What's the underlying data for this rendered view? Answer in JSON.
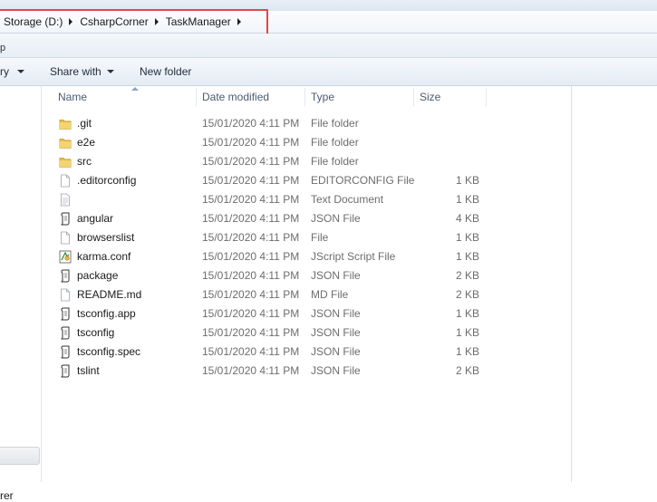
{
  "address": {
    "crumbs": [
      "Storage (D:)",
      "CsharpCorner",
      "TaskManager"
    ]
  },
  "menu_bar": {
    "partial_text": "p"
  },
  "toolbar": {
    "organize_partial": "ry",
    "share_with": "Share with",
    "new_folder": "New folder"
  },
  "nav_pane": {
    "partial_text": "rer"
  },
  "columns": {
    "name": "Name",
    "date": "Date modified",
    "type": "Type",
    "size": "Size"
  },
  "files": [
    {
      "name": ".git",
      "date": "15/01/2020 4:11 PM",
      "type": "File folder",
      "size": "",
      "icon": "folder-icon"
    },
    {
      "name": "e2e",
      "date": "15/01/2020 4:11 PM",
      "type": "File folder",
      "size": "",
      "icon": "folder-icon"
    },
    {
      "name": "src",
      "date": "15/01/2020 4:11 PM",
      "type": "File folder",
      "size": "",
      "icon": "folder-icon"
    },
    {
      "name": ".editorconfig",
      "date": "15/01/2020 4:11 PM",
      "type": "EDITORCONFIG File",
      "size": "1 KB",
      "icon": "file-icon"
    },
    {
      "name": "",
      "date": "15/01/2020 4:11 PM",
      "type": "Text Document",
      "size": "1 KB",
      "icon": "text-document-icon"
    },
    {
      "name": "angular",
      "date": "15/01/2020 4:11 PM",
      "type": "JSON File",
      "size": "4 KB",
      "icon": "json-file-icon"
    },
    {
      "name": "browserslist",
      "date": "15/01/2020 4:11 PM",
      "type": "File",
      "size": "1 KB",
      "icon": "file-icon"
    },
    {
      "name": "karma.conf",
      "date": "15/01/2020 4:11 PM",
      "type": "JScript Script File",
      "size": "1 KB",
      "icon": "jscript-file-icon"
    },
    {
      "name": "package",
      "date": "15/01/2020 4:11 PM",
      "type": "JSON File",
      "size": "2 KB",
      "icon": "json-file-icon"
    },
    {
      "name": "README.md",
      "date": "15/01/2020 4:11 PM",
      "type": "MD File",
      "size": "2 KB",
      "icon": "file-icon"
    },
    {
      "name": "tsconfig.app",
      "date": "15/01/2020 4:11 PM",
      "type": "JSON File",
      "size": "1 KB",
      "icon": "json-file-icon"
    },
    {
      "name": "tsconfig",
      "date": "15/01/2020 4:11 PM",
      "type": "JSON File",
      "size": "1 KB",
      "icon": "json-file-icon"
    },
    {
      "name": "tsconfig.spec",
      "date": "15/01/2020 4:11 PM",
      "type": "JSON File",
      "size": "1 KB",
      "icon": "json-file-icon"
    },
    {
      "name": "tslint",
      "date": "15/01/2020 4:11 PM",
      "type": "JSON File",
      "size": "2 KB",
      "icon": "json-file-icon"
    }
  ],
  "colors": {
    "highlight_box": "#e0474c",
    "folder_yellow": "#e8c04a",
    "header_text": "#4b5a6e"
  }
}
